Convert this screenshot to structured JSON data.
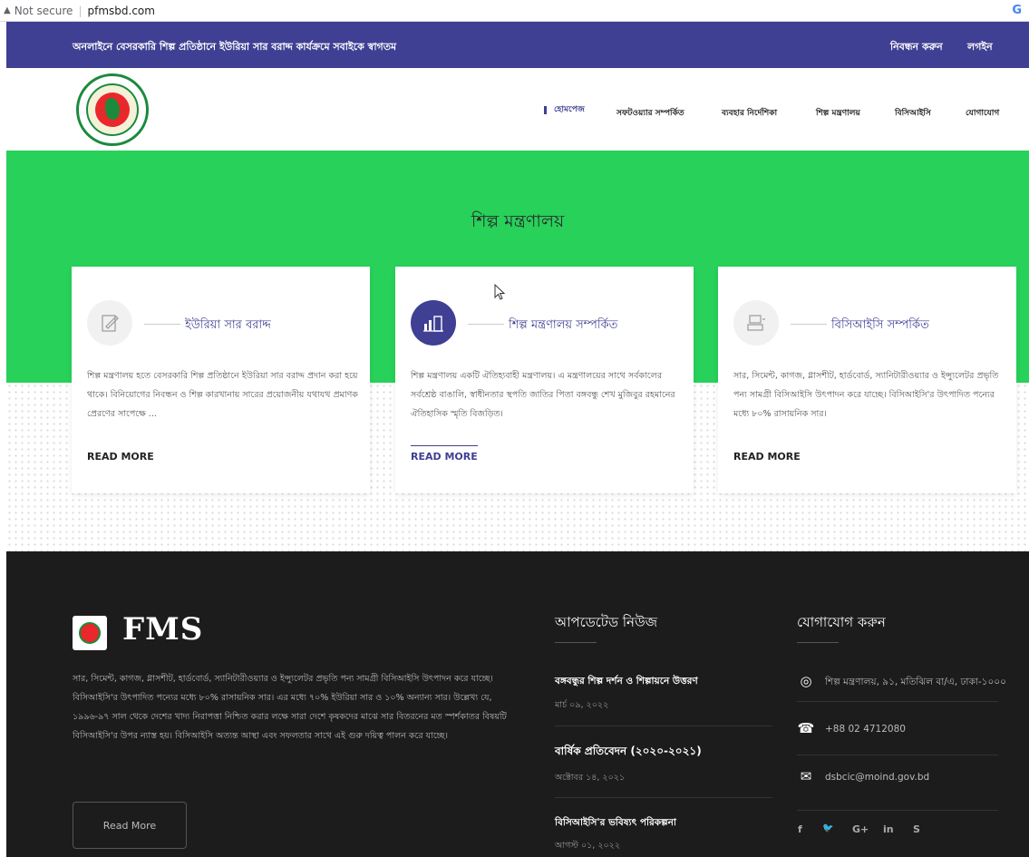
{
  "browser": {
    "security": "Not secure",
    "url": "pfmsbd.com",
    "profile": "G"
  },
  "topbar": {
    "welcome": "অনলাইনে বেসরকারি শিল্প প্রতিষ্ঠানে ইউরিয়া সার বরাদ্দ কার্যক্রমে সবাইকে স্বাগতম",
    "register": "নিবন্ধন করুন",
    "login": "লগইন"
  },
  "nav": {
    "home": "হোমপেজ",
    "about_software": "সফটওয়্যার সম্পর্কিত",
    "user_guide": "ব্যবহার নির্দেশিকা",
    "ministry": "শিল্প মন্ত্রণালয়",
    "bcic": "বিসিআইসি",
    "contact": "যোগাযোগ"
  },
  "hero": {
    "title": "শিল্প মন্ত্রণালয়"
  },
  "cards": [
    {
      "title": "ইউরিয়া সার বরাদ্দ",
      "text": "শিল্প মন্ত্রণালয় হতে বেসরকারি শিল্প প্রতিষ্ঠানে ইউরিয়া সার বরাদ্দ প্রদান করা হয়ে থাকে। বিনিয়োগের নিবন্ধন ও শিল্প কারখানায় সারের প্রয়োজনীয় যথাযথ প্রমাণক প্রেরণের সাপেক্ষে ...",
      "readmore": "READ MORE"
    },
    {
      "title": "শিল্প মন্ত্রণালয় সম্পর্কিত",
      "text": "শিল্প মন্ত্রণালয় একটি ঐতিহ্যবাহী মন্ত্রণালয়। এ মন্ত্রণালয়ের সাথে সর্বকালের সর্বশ্রেষ্ঠ বাঙালি, স্বাধীনতার স্থপতি জাতির পিতা বঙ্গবন্ধু শেখ মুজিবুর রহমানের ঐতিহাসিক স্মৃতি বিজড়িত।",
      "readmore": "READ MORE"
    },
    {
      "title": "বিসিআইসি সম্পর্কিত",
      "text": "সার, সিমেন্ট, কাগজ, গ্লাসশীট, হার্ডবোর্ড, স্যানিটারীওয়্যার ও ইন্স্যুলেটর প্রভৃতি পন্য সামগ্রী বিসিআইসি উৎপাদন করে যাচ্ছে। বিসিআইসি'র উৎপাদিত পন্যের মধ্যে ৮০% রাসায়নিক সার।",
      "readmore": "READ MORE"
    }
  ],
  "footer": {
    "brand": "FMS",
    "about": "সার, সিমেন্ট, কাগজ, গ্লাসশীট, হার্ডবোর্ড, স্যানিটারীওয়্যার ও ইন্স্যুলেটর প্রভৃতি পন্য সামগ্রী বিসিআইসি উৎপাদন করে যাচ্ছে। বিসিআইসি'র উৎপাদিত পন্যের মধ্যে ৮০% রাসায়নিক সার। এর মধ্যে ৭০% ইউরিয়া সার ও ১০% অন্যান্য সার। উল্লেখ্য যে, ১৯৯৬-৯৭ সাল থেকে দেশের খাদ্য নিরাপত্তা নিশ্চিত করার লক্ষে সারা দেশে কৃষকদের মাঝে সার বিতরনের মত স্পর্শকাতর বিষয়টি বিসিআইসি'র উপর ন্যাস্ত হয়। বিসিআইসি অত্যন্ত আস্থা এবং সফলতার সাথে এই গুরু দয়িত্ব পালন করে যাচ্ছে।",
    "read_more": "Read More",
    "news_heading": "আপডেটেড নিউজ",
    "news": [
      {
        "title": "বঙ্গবন্ধুর শিল্প দর্শন ও শিল্পায়নে উত্তরণ",
        "date": "মার্চ ০৯, ২০২২"
      },
      {
        "title": "বার্ষিক প্রতিবেদন (২০২০-২০২১)",
        "date": "অক্টোবর ১৪, ২০২১"
      },
      {
        "title": "বিসিআইসি'র ভবিষ্যৎ পরিকল্পনা",
        "date": "আগস্ট ০১, ২০২২"
      }
    ],
    "contact_heading": "যোগাযোগ করুন",
    "contact": {
      "address": "শিল্প মন্ত্রণালয়, ৯১, মতিঝিল বা/এ, ঢাকা-১০০০",
      "phone": "+88 02 4712080",
      "email": "dsbcic@moind.gov.bd"
    },
    "social": {
      "facebook": "f",
      "twitter": "🐦",
      "google": "G+",
      "linkedin": "in",
      "skype": "S"
    }
  },
  "colors": {
    "primary": "#3f3f93",
    "hero": "#27d15a",
    "footer": "#1c1c1c"
  }
}
